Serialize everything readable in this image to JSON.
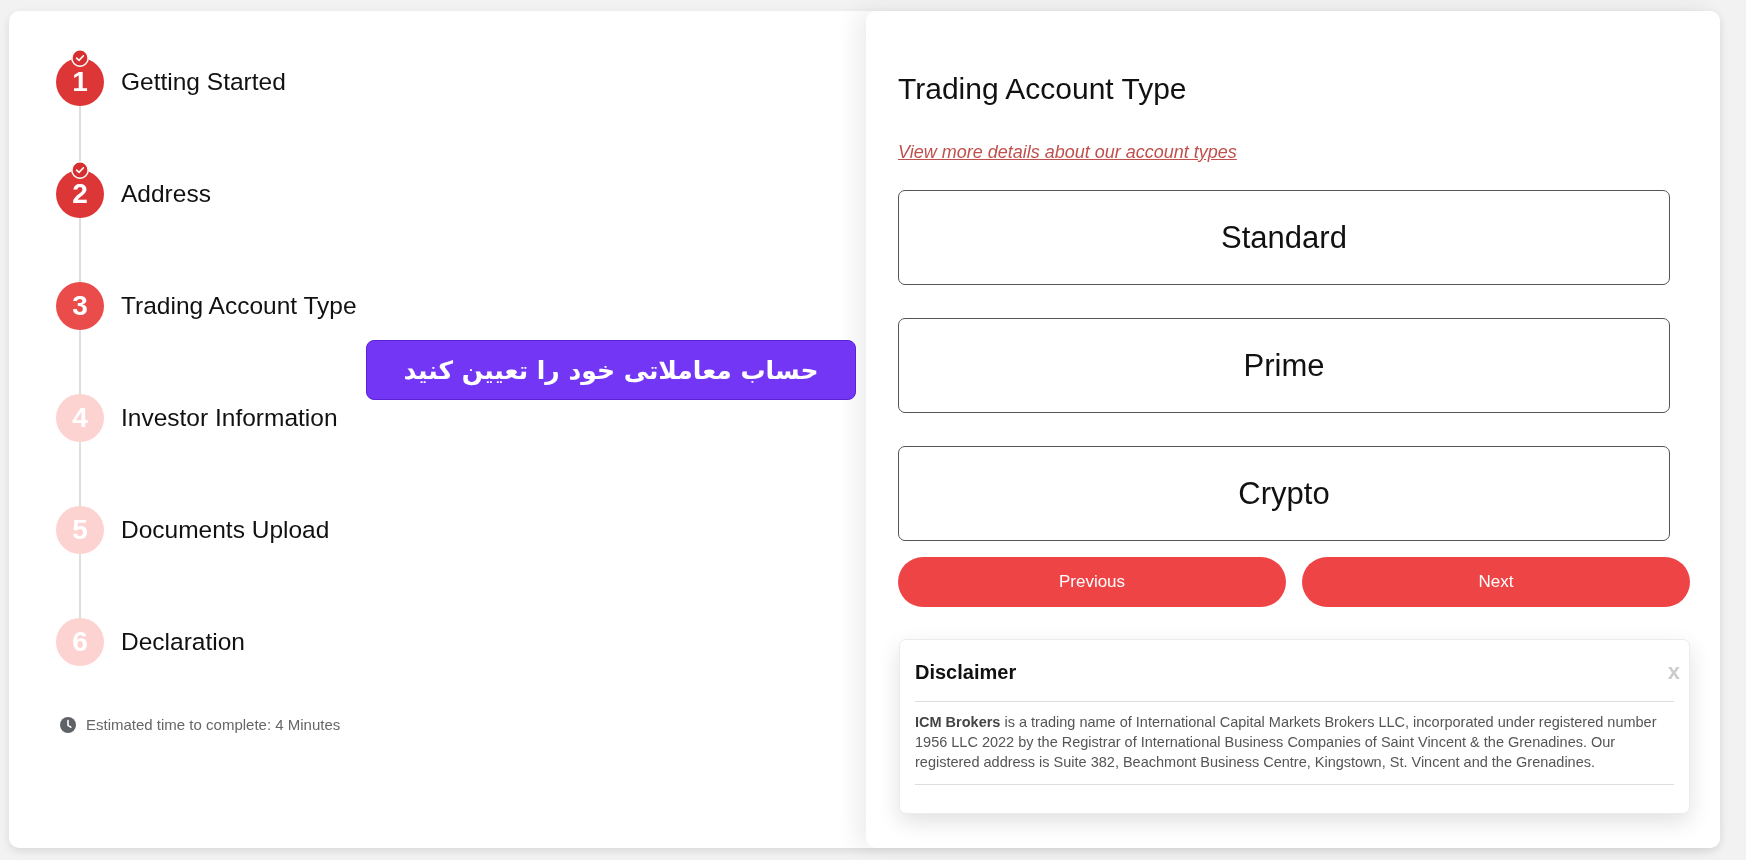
{
  "steps": [
    {
      "number": "1",
      "label": "Getting Started",
      "completed": true,
      "selected": false
    },
    {
      "number": "2",
      "label": "Address",
      "completed": true,
      "selected": false
    },
    {
      "number": "3",
      "label": "Trading Account Type",
      "completed": false,
      "selected": true
    },
    {
      "number": "4",
      "label": "Investor Information",
      "completed": false,
      "selected": false
    },
    {
      "number": "5",
      "label": "Documents Upload",
      "completed": false,
      "selected": false
    },
    {
      "number": "6",
      "label": "Declaration",
      "completed": false,
      "selected": false
    }
  ],
  "estimate": {
    "text": "Estimated time to complete: 4 Minutes"
  },
  "callout": {
    "text": "حساب معاملاتی خود را تعیین کنید"
  },
  "form": {
    "title": "Trading Account Type",
    "details_link": "View more details about our account types",
    "account_types": [
      {
        "label": "Standard",
        "selected": false
      },
      {
        "label": "Prime",
        "selected": false
      },
      {
        "label": "Crypto",
        "selected": false
      }
    ],
    "buttons": [
      "Previous",
      "Next"
    ]
  },
  "disclaimer": {
    "title": "Disclaimer",
    "close": "x",
    "text": "**ICM Brokers** is a trading name of International Capital Markets Brokers LLC, incorporated under registered number 1956 LLC 2022 by the Registrar of International Business Companies of Saint Vincent & the Grenadines. Our registered address is Suite 382, Beachmont Business Centre, Kingstown, St. Vincent and the Grenadines."
  }
}
